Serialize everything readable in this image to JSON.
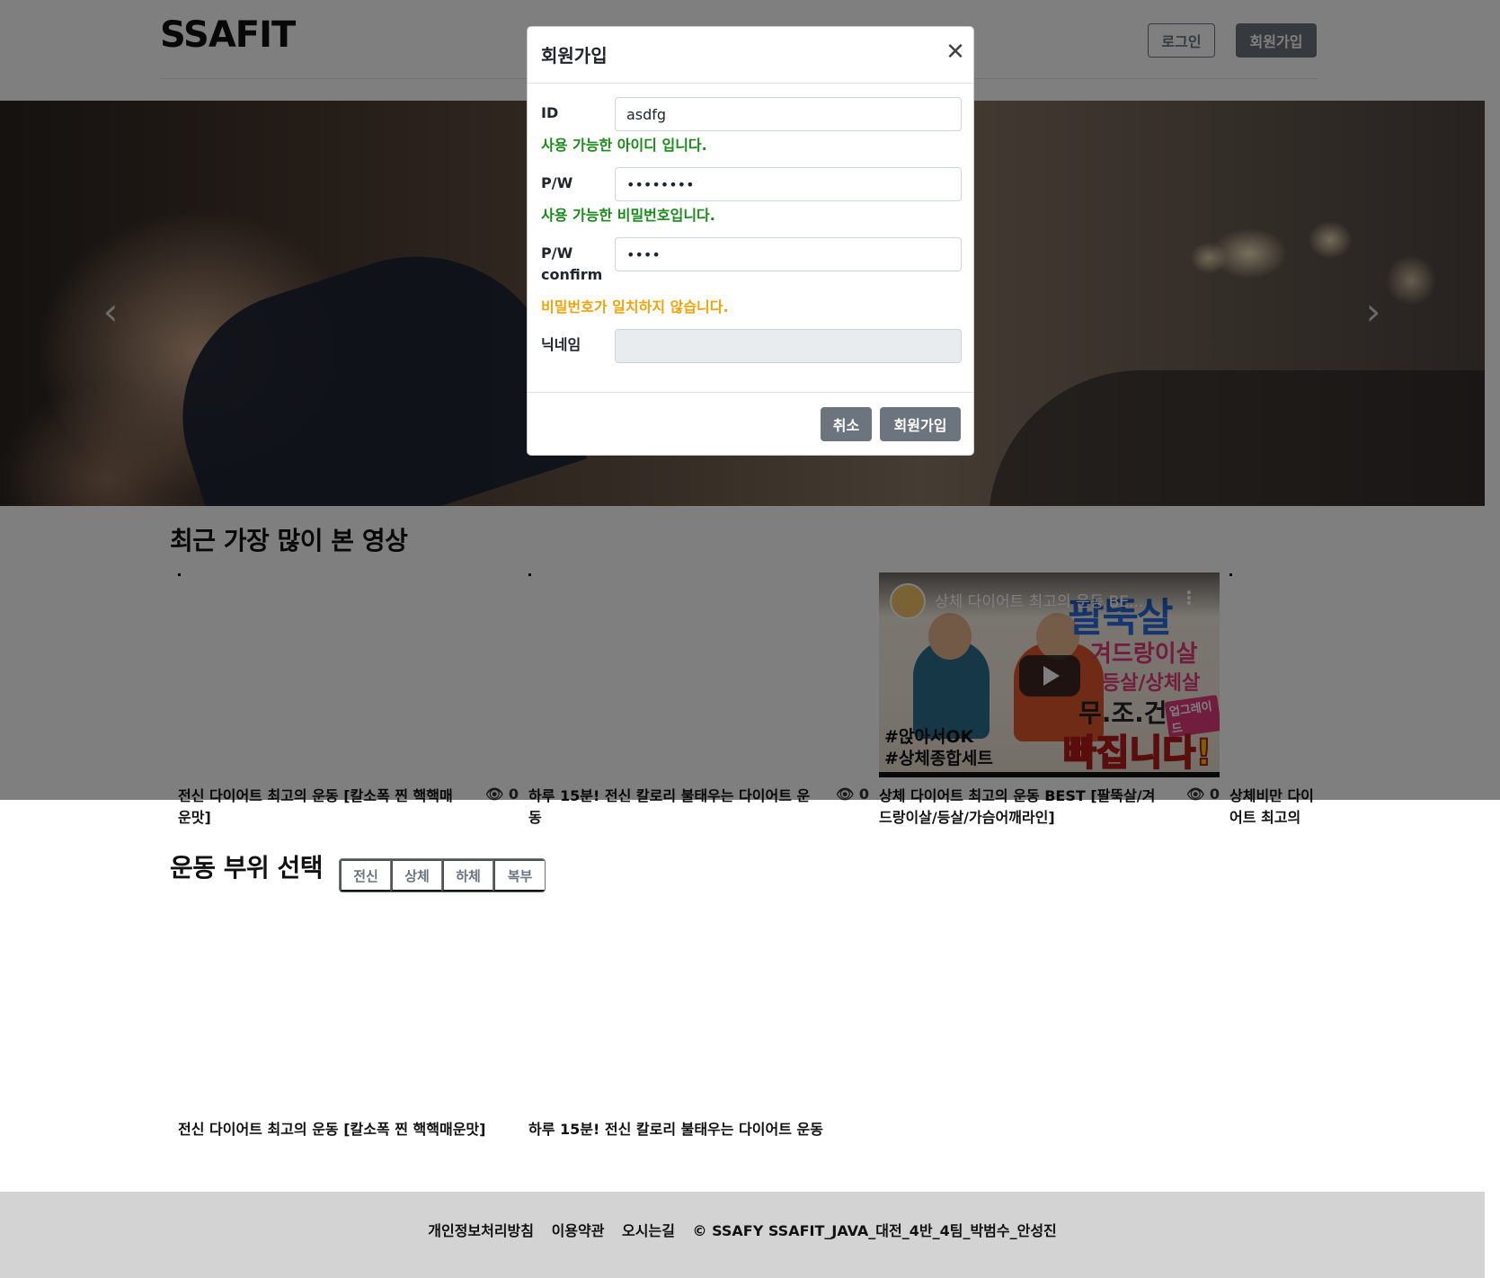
{
  "header": {
    "logo": "SSAFIT",
    "login_label": "로그인",
    "signup_label": "회원가입"
  },
  "carousel": {
    "prev_icon": "chevron-left-icon",
    "next_icon": "chevron-right-icon"
  },
  "recent": {
    "title": "최근 가장 많이 본 영상",
    "videos": [
      {
        "title": "전신 다이어트 최고의 운동 [칼소폭 찐 핵핵매운맛]",
        "views": "0"
      },
      {
        "title": "하루 15분! 전신 칼로리 불태우는 다이어트 운동",
        "views": "0"
      },
      {
        "title": "상체 다이어트 최고의 운동 BEST [팔뚝살/겨드랑이살/등살/가슴어깨라인]",
        "views": "0"
      },
      {
        "title": "상체비만 다이어트 최고의 운동 [상체 핵매운맛]",
        "views": ""
      }
    ],
    "yt": {
      "title": "상체 다이어트 최고의 운동 BE...",
      "text1": "팔뚝살",
      "text2": "겨드랑이살",
      "text3": "등살/상체살",
      "text4": "무.조.건",
      "text5": "업그레이드",
      "text6": "빠집니다!",
      "tag1": "#앉아서OK",
      "tag2": "#상체종합세트"
    }
  },
  "parts": {
    "title": "운동 부위 선택",
    "tabs": [
      "전신",
      "상체",
      "하체",
      "복부"
    ],
    "videos": [
      {
        "title": "전신 다이어트 최고의 운동 [칼소폭 찐 핵핵매운맛]"
      },
      {
        "title": "하루 15분! 전신 칼로리 불태우는 다이어트 운동"
      }
    ]
  },
  "footer": {
    "privacy": "개인정보처리방침",
    "terms": "이용약관",
    "directions": "오시는길",
    "copyright": "© SSAFY SSAFIT_JAVA_대전_4반_4팀_박범수_안성진"
  },
  "modal": {
    "title": "회원가입",
    "id_label": "ID",
    "id_value": "asdfg",
    "id_msg": "사용 가능한 아이디 입니다.",
    "pw_label": "P/W",
    "pw_value": "••••••••",
    "pw_msg": "사용 가능한 비밀번호입니다.",
    "pwc_label_1": "P/W",
    "pwc_label_2": "confirm",
    "pwc_value": "••••",
    "pwc_msg": "비밀번호가 일치하지 않습니다.",
    "nick_label": "닉네임",
    "nick_value": "",
    "cancel_label": "취소",
    "submit_label": "회원가입"
  },
  "colors": {
    "ok": "#1a8a1a",
    "warn": "#f0a30a",
    "secondary": "#6c757d"
  }
}
